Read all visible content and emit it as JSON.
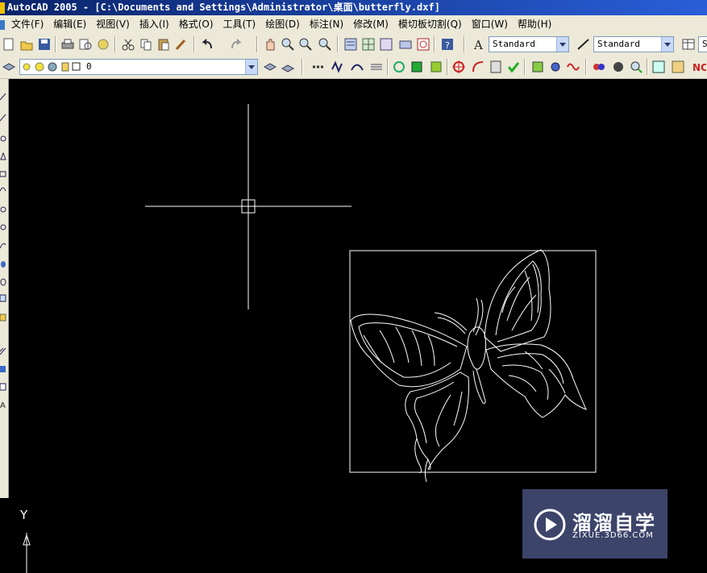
{
  "window": {
    "title": "AutoCAD 2005 - [C:\\Documents and Settings\\Administrator\\桌面\\butterfly.dxf]"
  },
  "menu": {
    "items": [
      {
        "label": "文件(F)"
      },
      {
        "label": "编辑(E)"
      },
      {
        "label": "视图(V)"
      },
      {
        "label": "插入(I)"
      },
      {
        "label": "格式(O)"
      },
      {
        "label": "工具(T)"
      },
      {
        "label": "绘图(D)"
      },
      {
        "label": "标注(N)"
      },
      {
        "label": "修改(M)"
      },
      {
        "label": "模切板切割(Q)"
      },
      {
        "label": "窗口(W)"
      },
      {
        "label": "帮助(H)"
      }
    ]
  },
  "toolbar": {
    "text_style": "Standard",
    "dim_style": "Standard",
    "table_style_partial": "S",
    "layer_value": "0"
  },
  "ucs": {
    "y_label": "Y"
  },
  "watermark": {
    "title": "溜溜自学",
    "url": "ZIXUE.3D66.COM"
  },
  "colors": {
    "canvas": "#000000",
    "geometry": "#ffffff",
    "toolbar_bg": "#ece9d8",
    "titlebar": "#0a246a"
  }
}
